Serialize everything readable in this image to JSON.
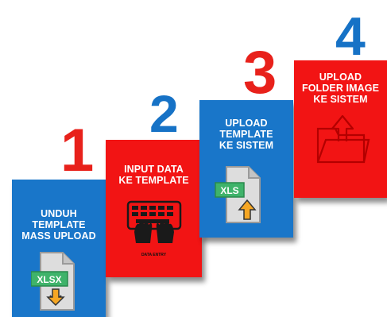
{
  "colors": {
    "blue": "#1976c9",
    "red": "#f21414",
    "file_gray": "#dddddd",
    "label_green": "#3fb36a",
    "arrow_orange": "#f5a623"
  },
  "steps": [
    {
      "number": "1",
      "number_color": "#e8211b",
      "card_color": "#1976c9",
      "title": "UNDUH\nTEMPLATE\nMASS UPLOAD",
      "icon": "xlsx-download-icon",
      "icon_label": "XLSX"
    },
    {
      "number": "2",
      "number_color": "#1672c6",
      "card_color": "#f21414",
      "title": "INPUT DATA\nKE TEMPLATE",
      "icon": "data-entry-keyboard-icon",
      "icon_label": "DATA ENTRY"
    },
    {
      "number": "3",
      "number_color": "#e8211b",
      "card_color": "#1976c9",
      "title": "UPLOAD\nTEMPLATE\nKE SISTEM",
      "icon": "xls-upload-icon",
      "icon_label": "XLS"
    },
    {
      "number": "4",
      "number_color": "#1672c6",
      "card_color": "#f21414",
      "title": "UPLOAD\nFOLDER IMAGE\nKE SISTEM",
      "icon": "folder-upload-icon"
    }
  ]
}
